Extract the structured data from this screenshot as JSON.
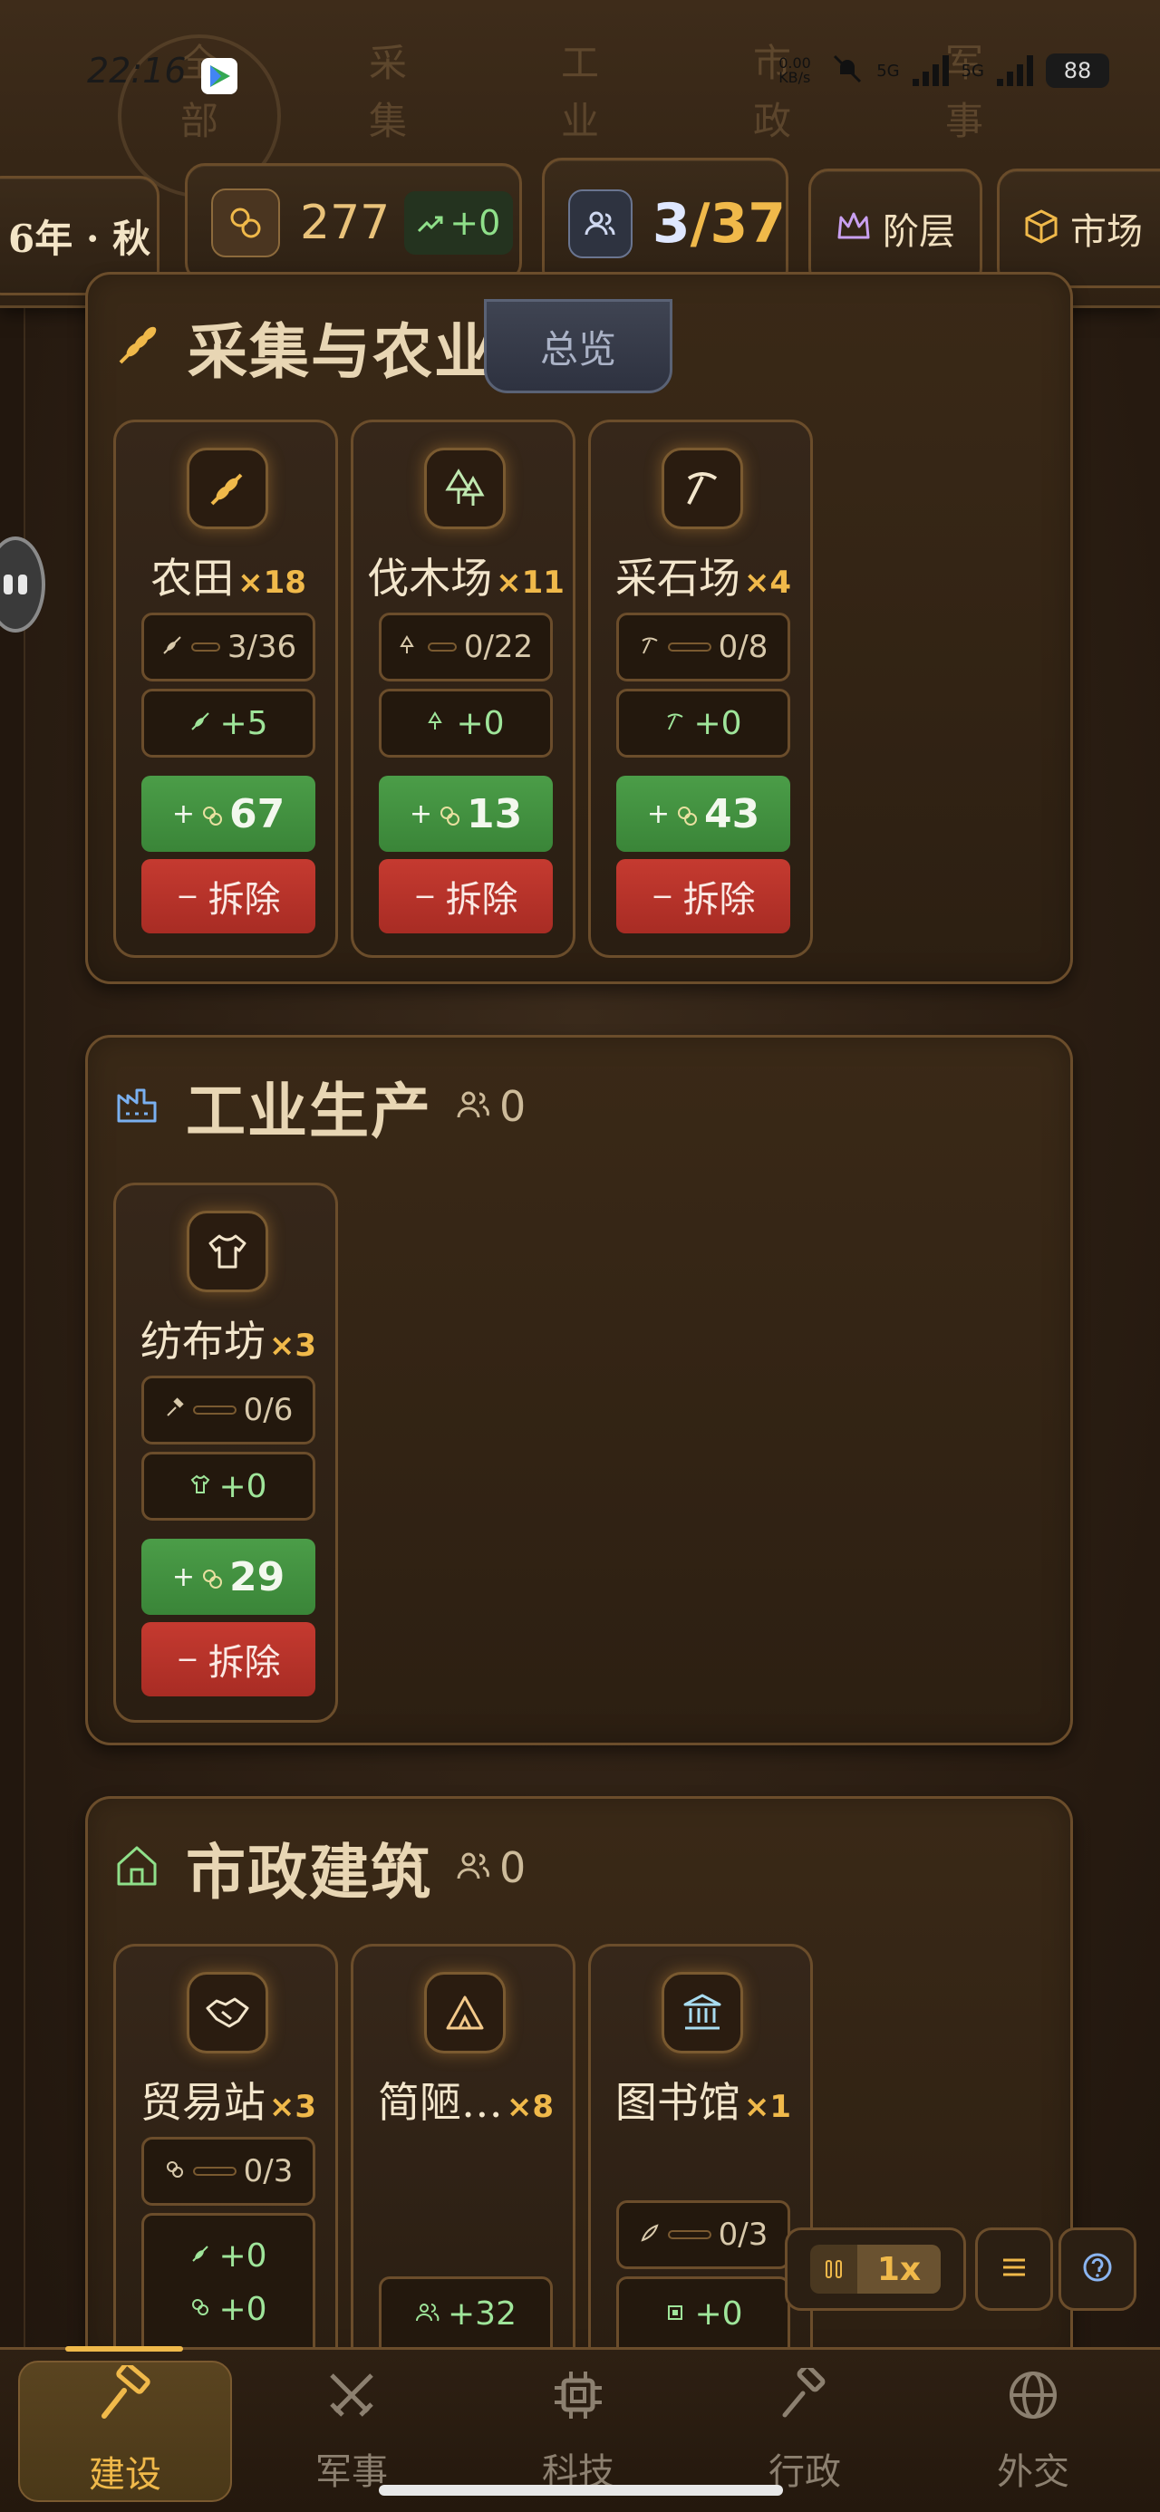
{
  "status_bar": {
    "time": "22:16",
    "network_speed": "0.00 KB/s",
    "signal_1": "5G",
    "signal_2": "5G",
    "battery": "88"
  },
  "ghost_tabs": [
    {
      "line1": "全",
      "line2": "部"
    },
    {
      "line1": "采",
      "line2": "集"
    },
    {
      "line1": "工",
      "line2": "业"
    },
    {
      "line1": "市",
      "line2": "政"
    },
    {
      "line1": "军",
      "line2": "事"
    }
  ],
  "header": {
    "season": "6年 · 秋",
    "gold": "277",
    "gold_delta": "+0",
    "population_current": "3",
    "population_max": "/37",
    "class_label": "阶层",
    "market_label": "市场",
    "overview_label": "总览"
  },
  "sections": {
    "gathering": {
      "title": "采集与农业",
      "cards": [
        {
          "name": "农田",
          "mult": "×18",
          "workers": "3/36",
          "output": "+5",
          "build_cost": "67",
          "demolish": "拆除",
          "icon": "wheat-icon"
        },
        {
          "name": "伐木场",
          "mult": "×11",
          "workers": "0/22",
          "output": "+0",
          "build_cost": "13",
          "demolish": "拆除",
          "icon": "tree-icon"
        },
        {
          "name": "采石场",
          "mult": "×4",
          "workers": "0/8",
          "output": "+0",
          "build_cost": "43",
          "demolish": "拆除",
          "icon": "pickaxe-icon"
        }
      ]
    },
    "industry": {
      "title": "工业生产",
      "worker_count": "0",
      "cards": [
        {
          "name": "纺布坊",
          "mult": "×3",
          "workers": "0/6",
          "output": "+0",
          "build_cost": "29",
          "demolish": "拆除",
          "icon": "shirt-icon"
        }
      ]
    },
    "civic": {
      "title": "市政建筑",
      "worker_count": "0",
      "cards": [
        {
          "name": "贸易站",
          "mult": "×3",
          "workers": "0/3",
          "output_1": "+0",
          "output_2": "+0",
          "icon": "handshake-icon"
        },
        {
          "name": "简陋…",
          "mult": "×8",
          "output": "+32",
          "icon": "tent-icon"
        },
        {
          "name": "图书馆",
          "mult": "×1",
          "workers": "0/3",
          "output": "+0",
          "icon": "library-icon"
        }
      ]
    }
  },
  "controls": {
    "speed": "1x"
  },
  "bottom_nav": [
    {
      "label": "建设",
      "icon": "hammer-icon",
      "active": true
    },
    {
      "label": "军事",
      "icon": "swords-icon",
      "active": false
    },
    {
      "label": "科技",
      "icon": "chip-icon",
      "active": false
    },
    {
      "label": "行政",
      "icon": "gavel-icon",
      "active": false
    },
    {
      "label": "外交",
      "icon": "globe-icon",
      "active": false
    }
  ],
  "colors": {
    "accent_gold": "#f0b94a",
    "build_green": "#4b9d48",
    "demolish_red": "#c53a30",
    "production_green": "#9fe59a"
  }
}
